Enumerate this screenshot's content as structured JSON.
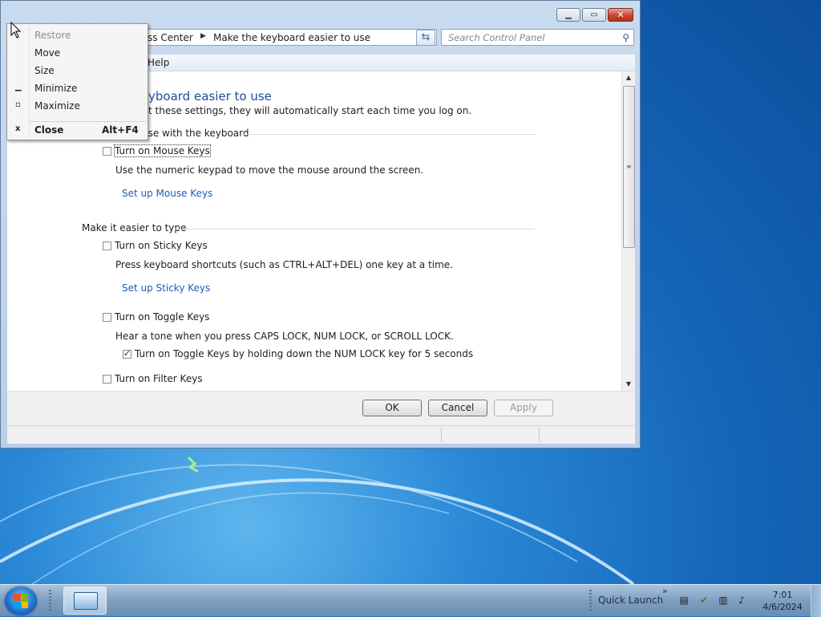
{
  "window": {
    "address_breadcrumb_1": "ss Center",
    "address_breadcrumb_2": "Make the keyboard easier to use",
    "search_placeholder": "Search Control Panel",
    "menu_help": "Help",
    "heading": "yboard easier to use",
    "subtext": "t these settings, they will automatically start each time you log on.",
    "sections": {
      "mouse_title": "use with the keyboard",
      "type_title": "Make it easier to type"
    },
    "mouse_keys": {
      "checkbox_label": "Turn on Mouse Keys",
      "description": "Use the numeric keypad to move the mouse around the screen.",
      "link": "Set up Mouse Keys",
      "checked": false
    },
    "sticky_keys": {
      "checkbox_label": "Turn on Sticky Keys",
      "description": "Press keyboard shortcuts (such as CTRL+ALT+DEL) one key at a time.",
      "link": "Set up Sticky Keys",
      "checked": false
    },
    "toggle_keys": {
      "checkbox_label": "Turn on Toggle Keys",
      "description": "Hear a tone when you press CAPS LOCK, NUM LOCK, or SCROLL LOCK.",
      "sub_checkbox_label": "Turn on Toggle Keys by holding down the NUM LOCK key for 5 seconds",
      "checked": false,
      "sub_checked": true
    },
    "filter_keys": {
      "checkbox_label": "Turn on Filter Keys",
      "checked": false
    },
    "buttons": {
      "ok": "OK",
      "cancel": "Cancel",
      "apply": "Apply"
    }
  },
  "context_menu": {
    "items": [
      {
        "label": "Restore",
        "enabled": false
      },
      {
        "label": "Move",
        "enabled": true
      },
      {
        "label": "Size",
        "enabled": true
      },
      {
        "label": "Minimize",
        "enabled": true
      },
      {
        "label": "Maximize",
        "enabled": true
      },
      {
        "label": "Close",
        "enabled": true,
        "shortcut": "Alt+F4"
      }
    ]
  },
  "taskbar": {
    "quick_launch": "Quick Launch",
    "time": "7:01",
    "date": "4/6/2024"
  },
  "colors": {
    "link": "#1f5cb5",
    "heading": "#1e4d9a",
    "close_button": "#c6452e"
  },
  "icons": {
    "search": "search-icon",
    "refresh": "refresh-icon",
    "start": "windows-logo-icon"
  }
}
